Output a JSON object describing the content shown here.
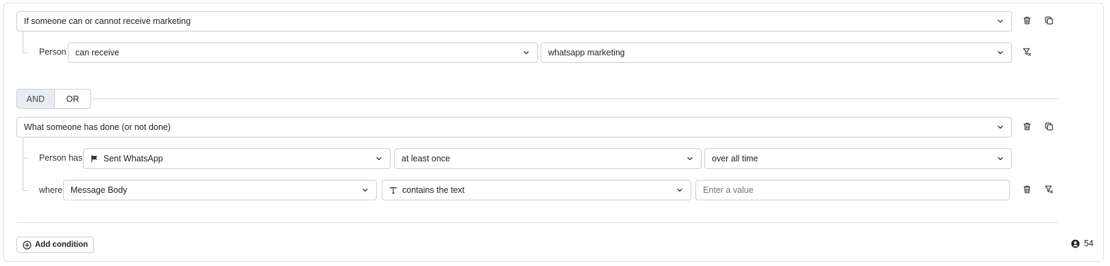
{
  "group1": {
    "select_label": "If someone can or cannot receive marketing",
    "row": {
      "label": "Person",
      "operator": "can receive",
      "channel": "whatsapp marketing"
    }
  },
  "logic_toggle": {
    "and_label": "AND",
    "or_label": "OR",
    "selected": "AND"
  },
  "group2": {
    "select_label": "What someone has done (or not done)",
    "row1": {
      "label": "Person has",
      "event": "Sent WhatsApp",
      "frequency": "at least once",
      "timeframe": "over all time"
    },
    "row2": {
      "label": "where",
      "property": "Message Body",
      "operator": "contains the text",
      "value": "",
      "value_placeholder": "Enter a value"
    }
  },
  "footer": {
    "add_condition_label": "Add condition",
    "audience_count": "54"
  },
  "icons": {
    "delete": "trash-icon",
    "duplicate": "copy-icon",
    "filter_clear": "filter-x-icon",
    "event": "flag-icon",
    "text_type": "text-type-icon",
    "add": "plus-circle-icon",
    "people": "user-circle-icon"
  }
}
